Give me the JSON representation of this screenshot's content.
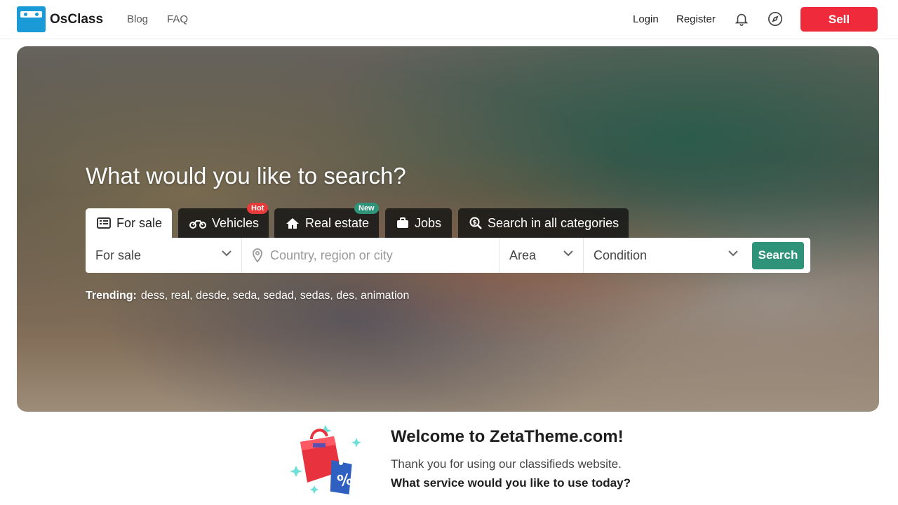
{
  "header": {
    "brand": "OsClass",
    "nav": [
      "Blog",
      "FAQ"
    ],
    "login": "Login",
    "register": "Register",
    "sell": "Sell"
  },
  "hero": {
    "title": "What would you like to search?",
    "tabs": [
      {
        "label": "For sale",
        "icon": "list-icon",
        "active": true
      },
      {
        "label": "Vehicles",
        "icon": "motorcycle-icon",
        "badge": "Hot"
      },
      {
        "label": "Real estate",
        "icon": "home-icon",
        "badge": "New"
      },
      {
        "label": "Jobs",
        "icon": "briefcase-icon"
      },
      {
        "label": "Search in all categories",
        "icon": "search-dollar-icon"
      }
    ],
    "search": {
      "category_value": "For sale",
      "location_placeholder": "Country, region or city",
      "area_value": "Area",
      "condition_value": "Condition",
      "button": "Search"
    },
    "trending": {
      "label": "Trending:",
      "terms": "dess, real, desde, seda, sedad, sedas, des, animation"
    }
  },
  "welcome": {
    "title": "Welcome to ZetaTheme.com!",
    "subtitle": "Thank you for using our classifieds website.",
    "question": "What service would you like to use today?"
  },
  "colors": {
    "brand_blue": "#1a9ad6",
    "sell_red": "#ef2a3a",
    "accent_green": "#2e9378",
    "hot_red": "#e53b3b"
  }
}
